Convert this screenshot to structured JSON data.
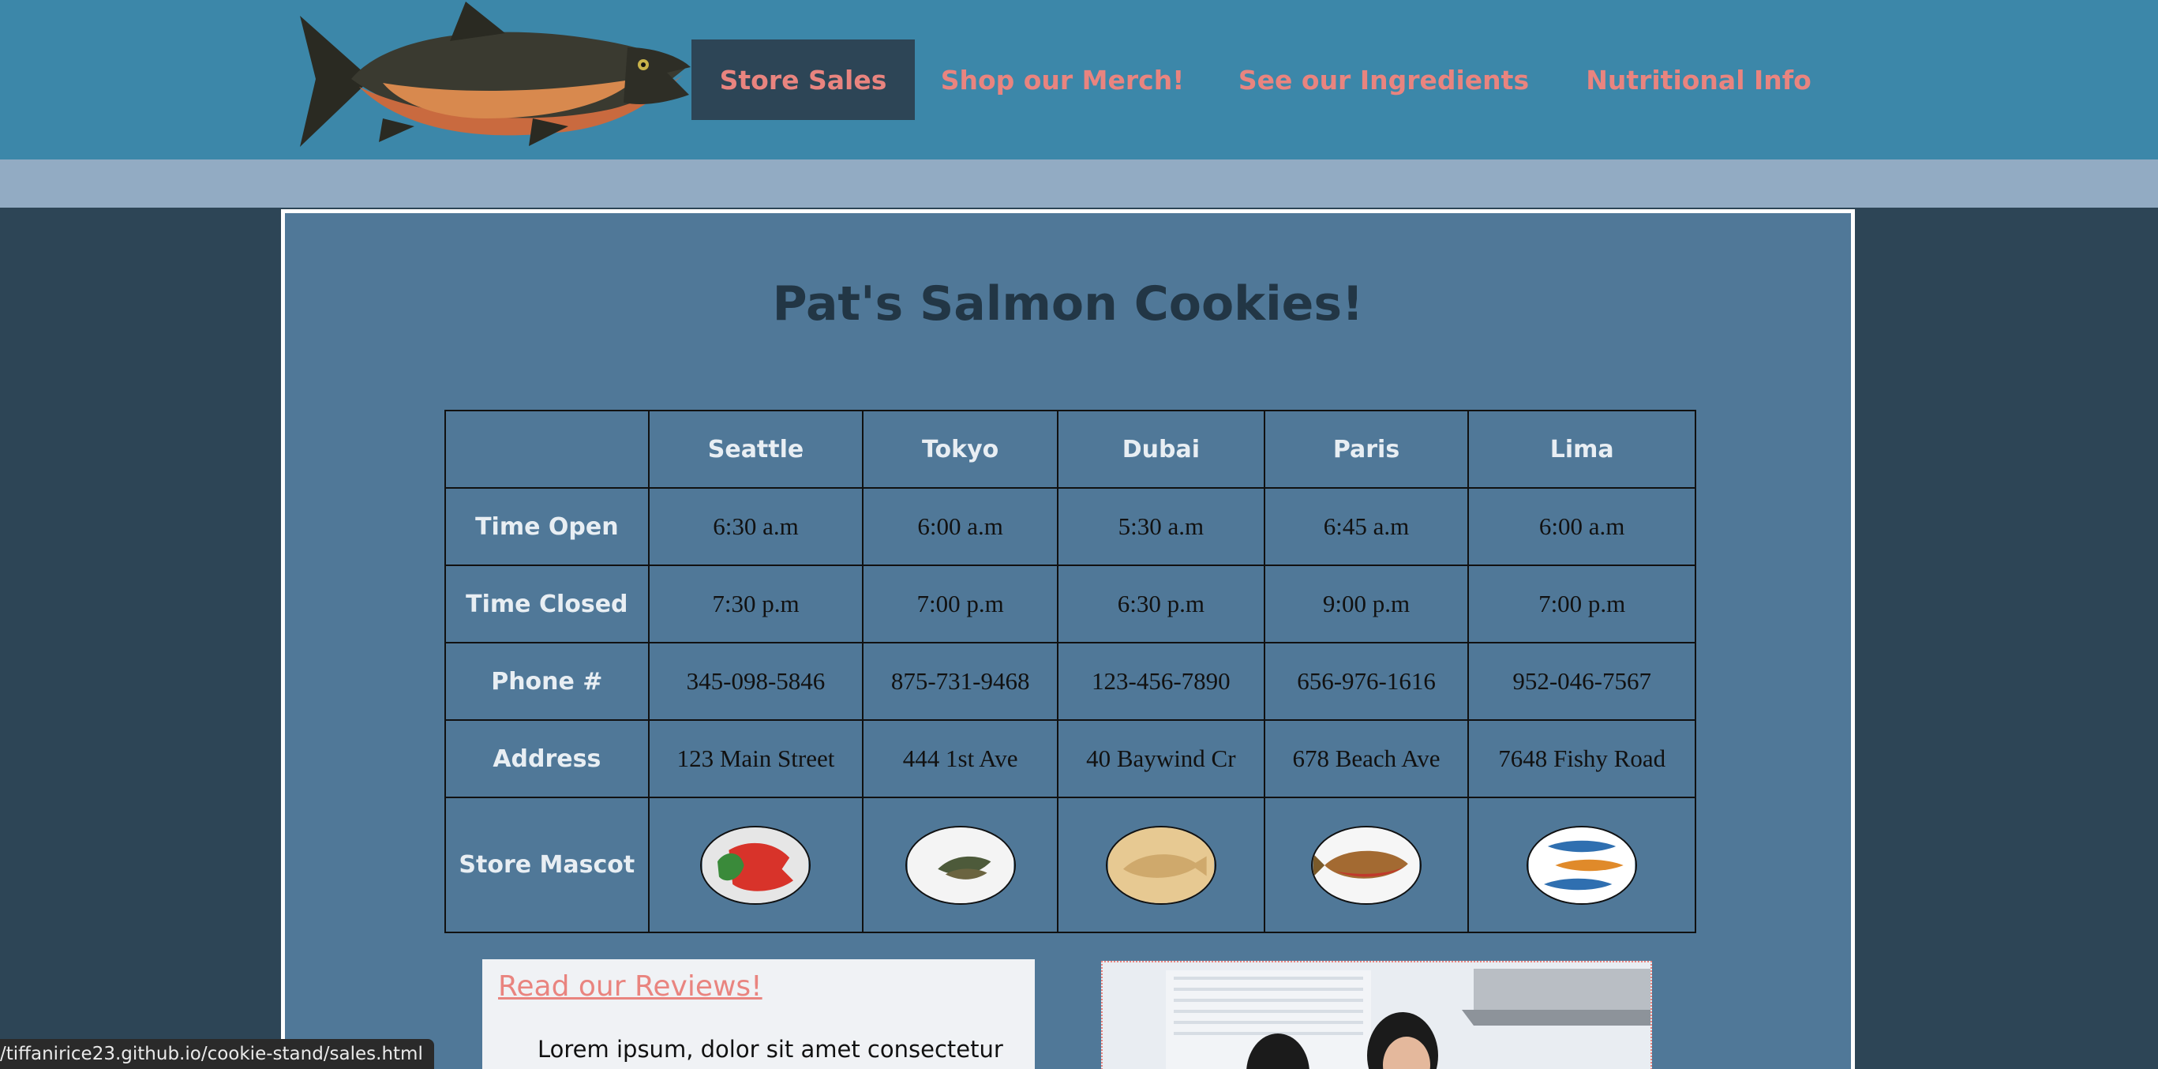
{
  "nav": {
    "items": [
      {
        "label": "Store Sales",
        "active": true
      },
      {
        "label": "Shop our Merch!",
        "active": false
      },
      {
        "label": "See our Ingredients",
        "active": false
      },
      {
        "label": "Nutritional Info",
        "active": false
      }
    ]
  },
  "main": {
    "title": "Pat's Salmon Cookies!",
    "table": {
      "columns": [
        "",
        "Seattle",
        "Tokyo",
        "Dubai",
        "Paris",
        "Lima"
      ],
      "rows": [
        {
          "label": "Time Open",
          "cells": [
            "6:30 a.m",
            "6:00 a.m",
            "5:30 a.m",
            "6:45 a.m",
            "6:00 a.m"
          ]
        },
        {
          "label": "Time Closed",
          "cells": [
            "7:30 p.m",
            "7:00 p.m",
            "6:30 p.m",
            "9:00 p.m",
            "7:00 p.m"
          ]
        },
        {
          "label": "Phone #",
          "cells": [
            "345-098-5846",
            "875-731-9468",
            "123-456-7890",
            "656-976-1616",
            "952-046-7567"
          ]
        },
        {
          "label": "Address",
          "cells": [
            "123 Main Street",
            "444 1st Ave",
            "40 Baywind Cr",
            "678 Beach Ave",
            "7648 Fishy Road"
          ]
        }
      ],
      "mascot_row_label": "Store Mascot",
      "mascots": [
        "crab-cookie-icon",
        "fish-shirt-icon",
        "fish-cookie-icon",
        "salmon-icon",
        "fish-trio-icon"
      ]
    },
    "reviews": {
      "link": "Read our Reviews!",
      "text": "Lorem ipsum, dolor sit amet consectetur"
    }
  },
  "status_bar": {
    "url": "/tiffanirice23.github.io/cookie-stand/sales.html"
  },
  "colors": {
    "header_bg": "#3c87a9",
    "subbar_bg": "#92abc3",
    "page_bg": "#2d4556",
    "panel_bg": "#507898",
    "nav_text": "#e9847f",
    "title_text": "#223645"
  }
}
